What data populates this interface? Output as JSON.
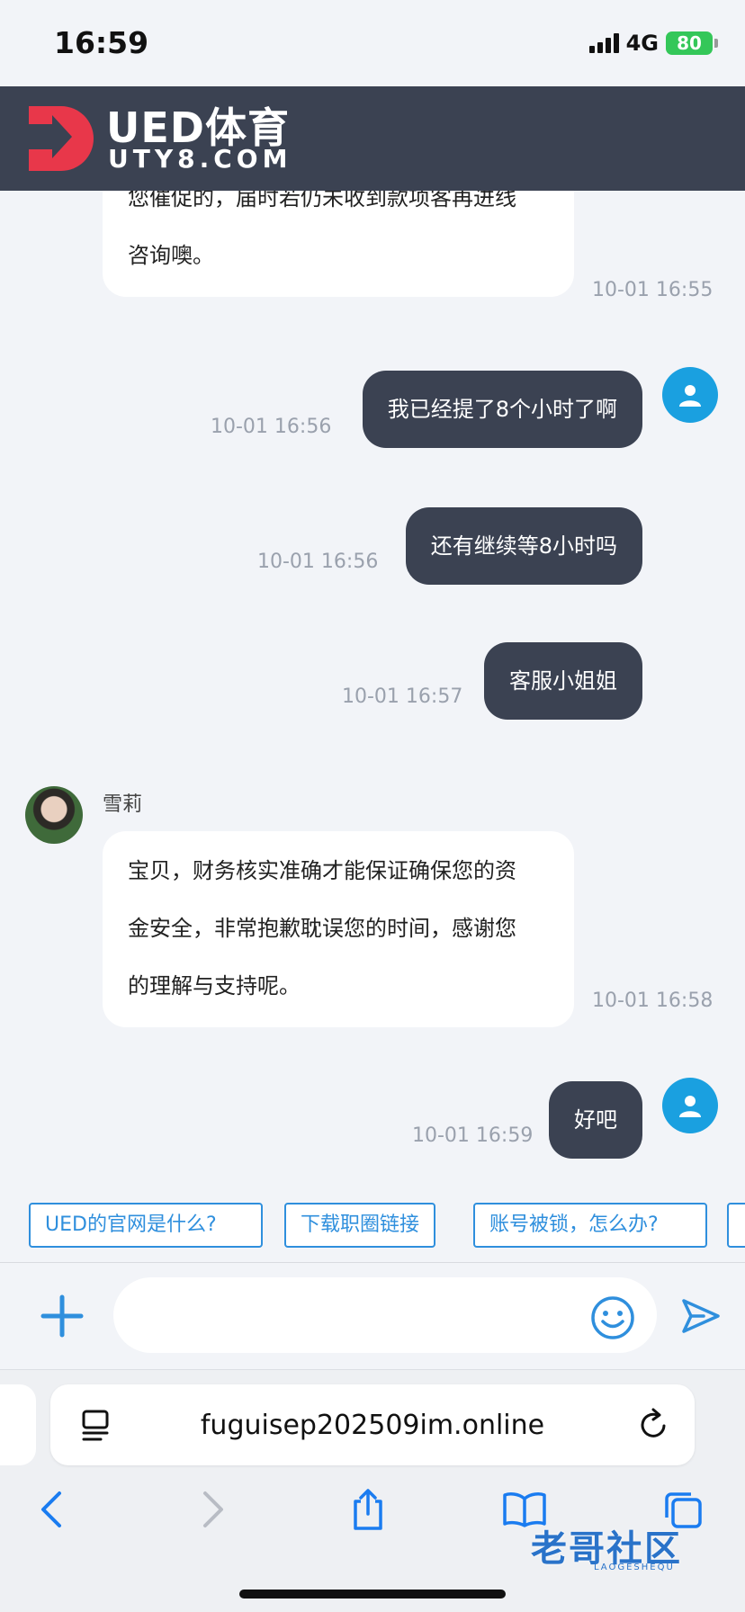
{
  "status": {
    "time": "16:59",
    "network": "4G",
    "battery": "80"
  },
  "header": {
    "brand": "UED体育",
    "domain": "UTY8.COM",
    "brand_color": "#e8374a",
    "bg_color": "#3b4252"
  },
  "messages": [
    {
      "from": "agent",
      "lines": [
        "您催促的，届时若仍未收到款项客再进线",
        "咨询噢。"
      ],
      "time": "10-01 16:55"
    },
    {
      "from": "user",
      "text": "我已经提了8个小时了啊",
      "time": "10-01 16:56"
    },
    {
      "from": "user",
      "text": "还有继续等8小时吗",
      "time": "10-01 16:56"
    },
    {
      "from": "user",
      "text": "客服小姐姐",
      "time": "10-01 16:57"
    },
    {
      "from": "agent",
      "name": "雪莉",
      "lines": [
        "宝贝，财务核实准确才能保证确保您的资",
        "金安全，非常抱歉耽误您的时间，感谢您",
        "的理解与支持呢。"
      ],
      "time": "10-01 16:58"
    },
    {
      "from": "user",
      "text": "好吧",
      "time": "10-01 16:59"
    }
  ],
  "quick_replies": [
    "UED的官网是什么?",
    "下载职圈链接",
    "账号被锁，怎么办?"
  ],
  "input": {
    "value": "",
    "placeholder": ""
  },
  "browser": {
    "url": "fuguisep202509im.online"
  },
  "watermark": {
    "title": "老哥社区",
    "sub": "LAOGESHEQU"
  }
}
